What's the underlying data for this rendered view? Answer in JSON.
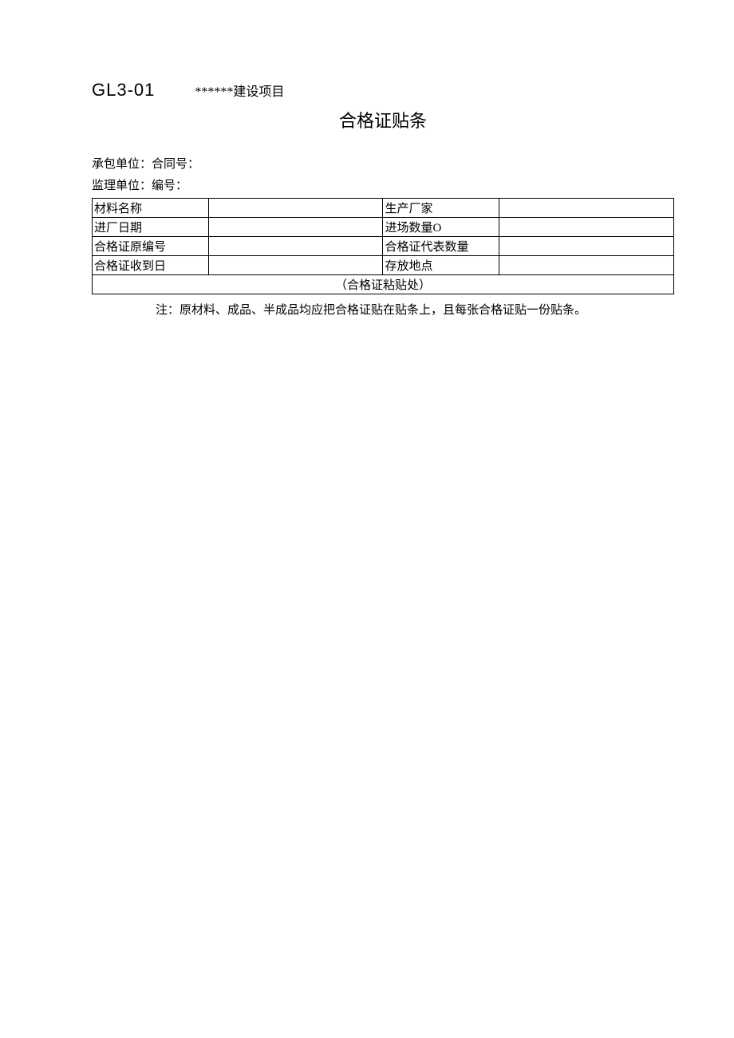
{
  "header": {
    "form_code": "GL3-01",
    "project_name": "******建设项目",
    "title": "合格证贴条"
  },
  "info": {
    "contractor_label": "承包单位：",
    "contract_no_label": "合同号：",
    "supervisor_label": "监理单位：",
    "serial_no_label": "编号："
  },
  "table": {
    "r1c1": "材料名称",
    "r1c2": "",
    "r1c3": "生产厂家",
    "r1c4": "",
    "r2c1": "进厂日期",
    "r2c2": "",
    "r2c3": "进场数量O",
    "r2c4": "",
    "r3c1": "合格证原编号",
    "r3c2": "",
    "r3c3": "合格证代表数量",
    "r3c4": "",
    "r4c1": "合格证收到日",
    "r4c2": "",
    "r4c3": "存放地点",
    "r4c4": "",
    "paste_area": "（合格证粘贴处）"
  },
  "note": "注：原材料、成品、半成品均应把合格证贴在贴条上，且每张合格证贴一份贴条。"
}
